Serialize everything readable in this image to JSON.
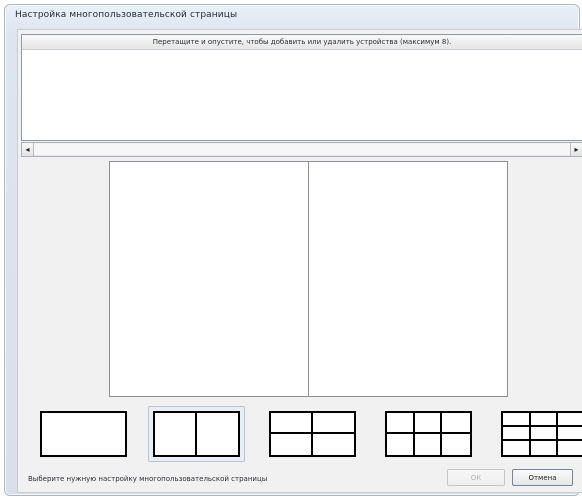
{
  "window": {
    "title": "Настройка многопользовательской страницы"
  },
  "device_strip": {
    "instruction": "Перетащите и опустите, чтобы добавить или удалить устройства (максимум 8)."
  },
  "scrollbar": {
    "left_arrow": "◂",
    "right_arrow": "▸"
  },
  "preview": {
    "panes": 2
  },
  "layouts": [
    {
      "name": "1x1",
      "cols": 1,
      "rows": 1
    },
    {
      "name": "2x1",
      "cols": 2,
      "rows": 1
    },
    {
      "name": "2x2",
      "cols": 2,
      "rows": 2
    },
    {
      "name": "3x2",
      "cols": 3,
      "rows": 2
    },
    {
      "name": "3x3",
      "cols": 3,
      "rows": 3
    }
  ],
  "selected_layout": 1,
  "footer": {
    "hint": "Выберите нужную настройку многопользовательской страницы",
    "ok_label": "ОК",
    "cancel_label": "Отмена"
  }
}
